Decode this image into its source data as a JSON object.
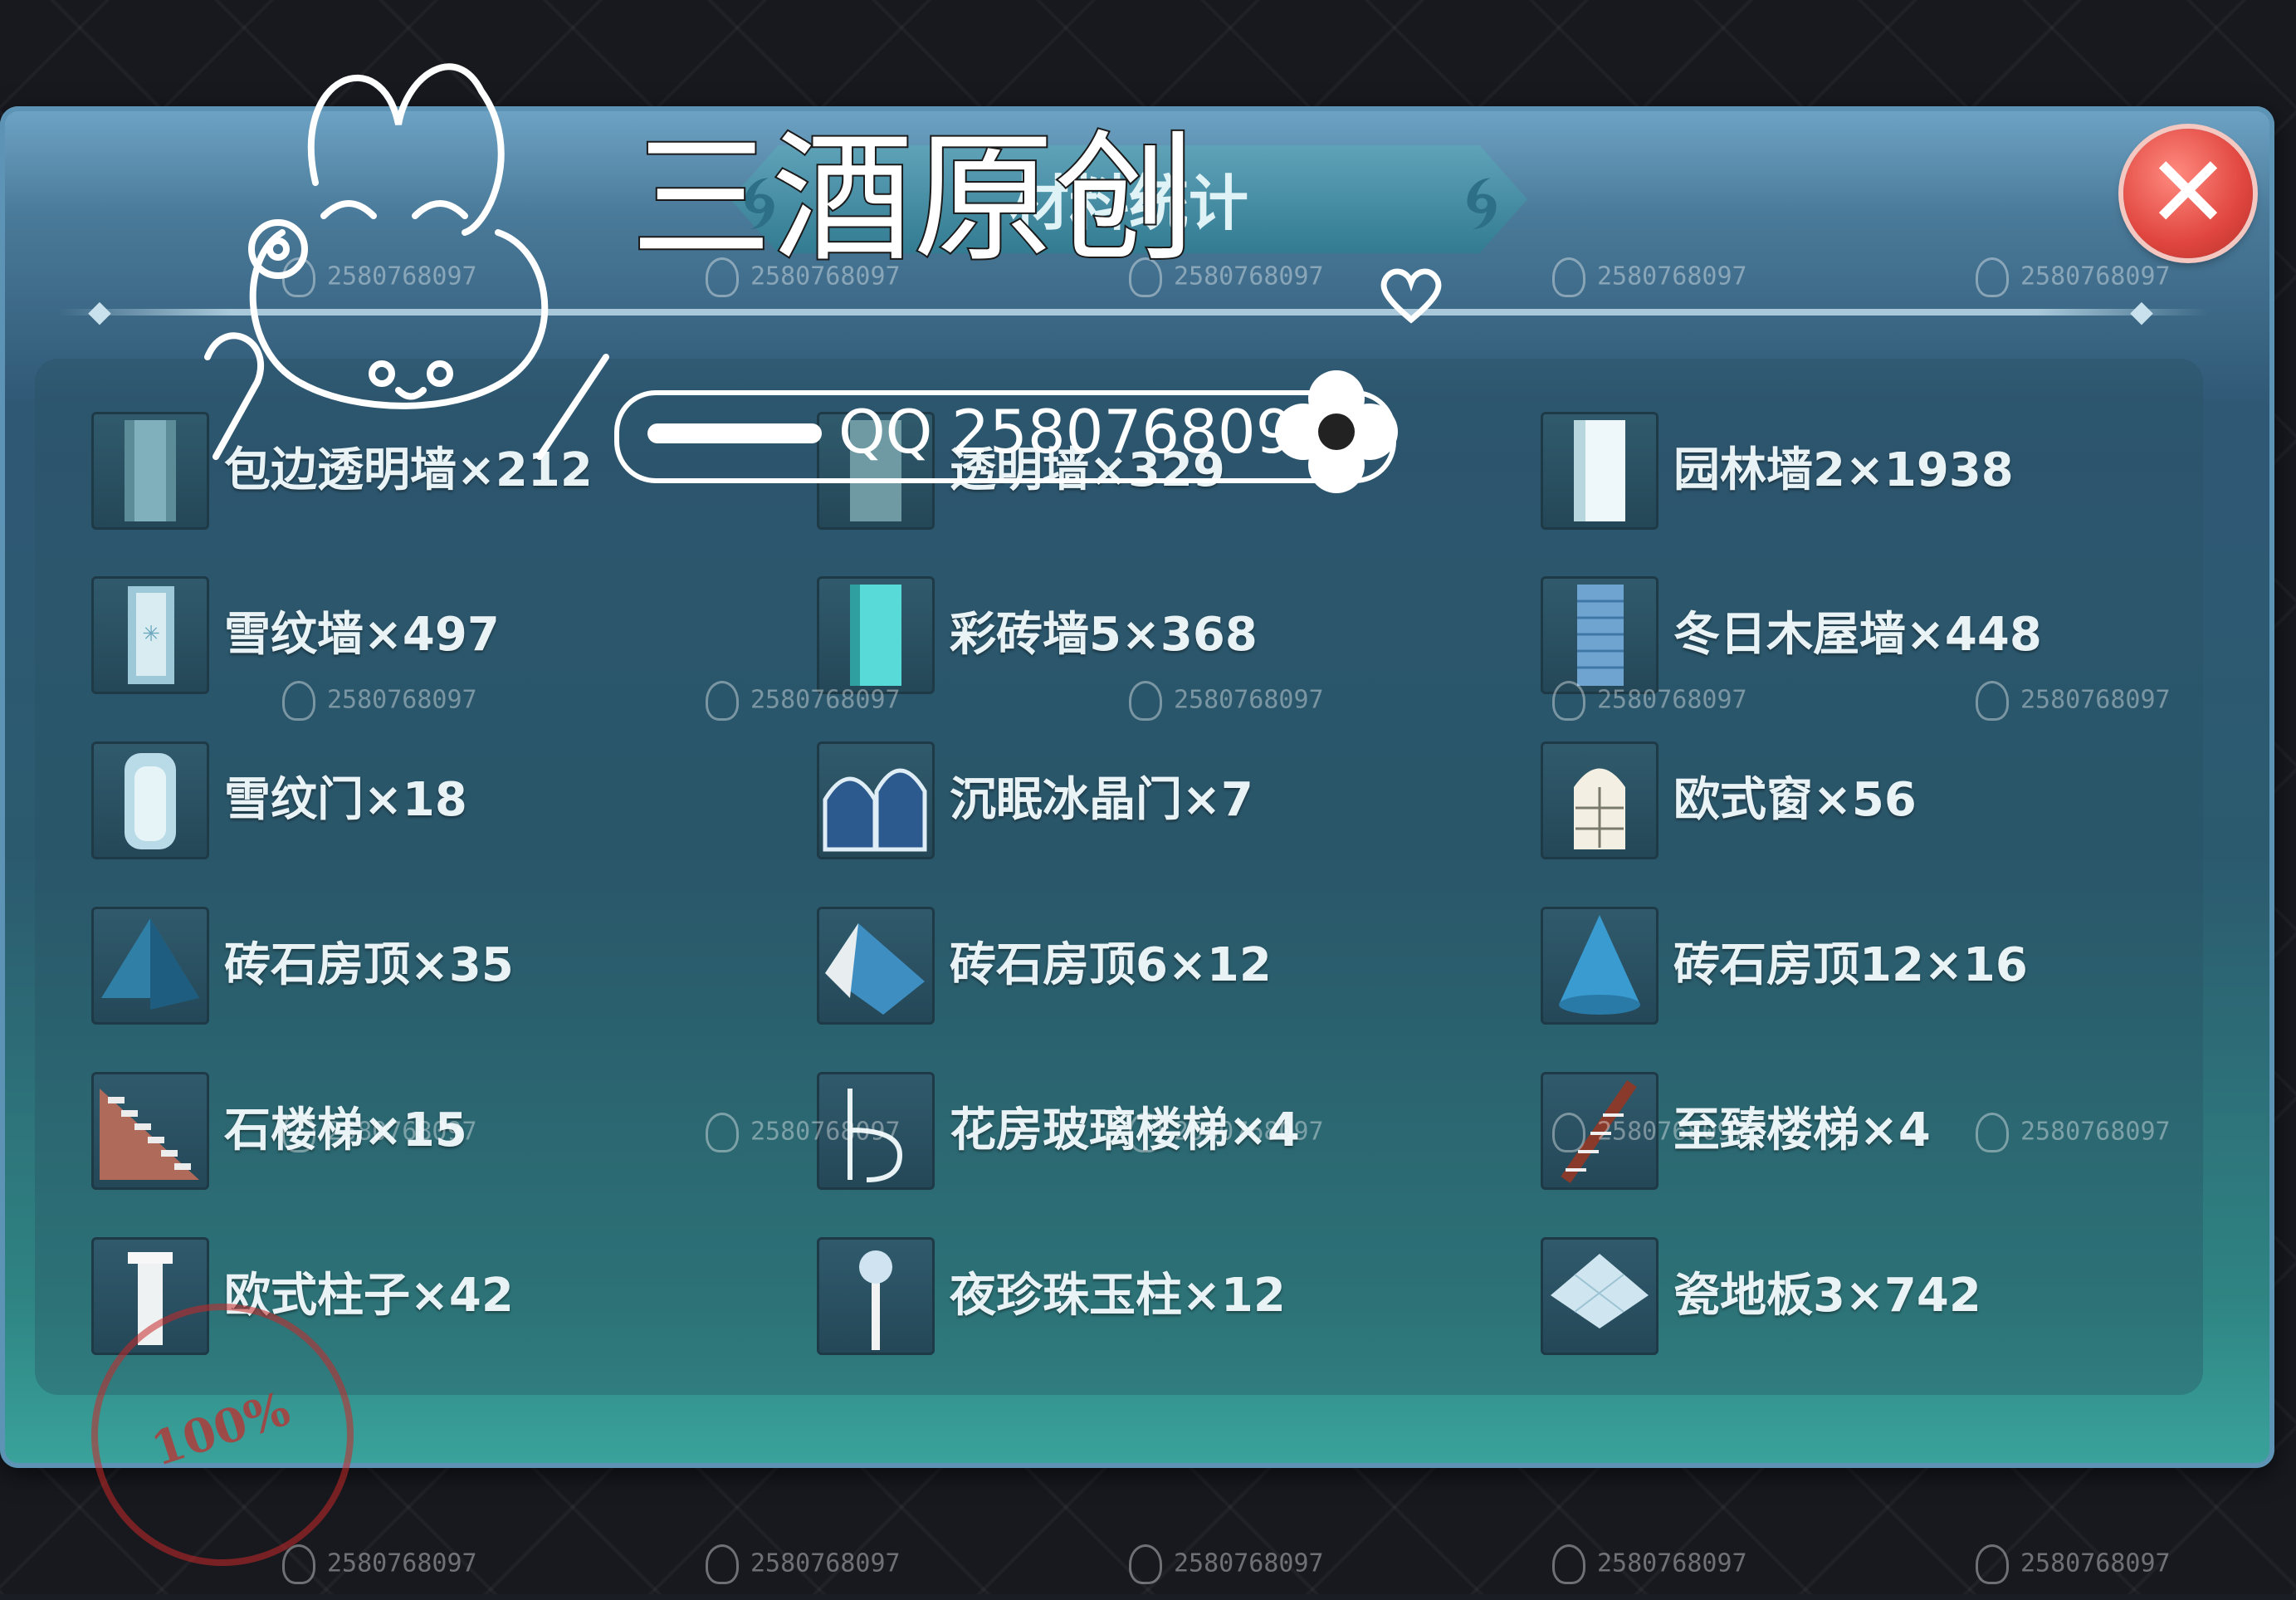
{
  "title": "材料统计",
  "overlay": {
    "brand": "三酒原创",
    "qq": "QQ 2580768097",
    "stamp": "100%"
  },
  "watermark_text": "2580768097",
  "close_icon": "close-icon",
  "items": [
    {
      "label": "包边透明墙×212",
      "icon": "glass-wall-icon"
    },
    {
      "label": "透明墙×329",
      "icon": "transparent-wall-icon"
    },
    {
      "label": "园林墙2×1938",
      "icon": "garden-wall-icon"
    },
    {
      "label": "雪纹墙×497",
      "icon": "snow-wall-icon"
    },
    {
      "label": "彩砖墙5×368",
      "icon": "color-brick-wall-icon"
    },
    {
      "label": "冬日木屋墙×448",
      "icon": "winter-cabin-wall-icon"
    },
    {
      "label": "雪纹门×18",
      "icon": "snow-door-icon"
    },
    {
      "label": "沉眠冰晶门×7",
      "icon": "ice-crystal-door-icon"
    },
    {
      "label": "欧式窗×56",
      "icon": "european-window-icon"
    },
    {
      "label": "砖石房顶×35",
      "icon": "pyramid-roof-icon"
    },
    {
      "label": "砖石房顶6×12",
      "icon": "gable-roof-icon"
    },
    {
      "label": "砖石房顶12×16",
      "icon": "cone-roof-icon"
    },
    {
      "label": "石楼梯×15",
      "icon": "stone-stairs-icon"
    },
    {
      "label": "花房玻璃楼梯×4",
      "icon": "spiral-stairs-icon"
    },
    {
      "label": "至臻楼梯×4",
      "icon": "premium-stairs-icon"
    },
    {
      "label": "欧式柱子×42",
      "icon": "european-pillar-icon"
    },
    {
      "label": "夜珍珠玉柱×12",
      "icon": "pearl-pillar-icon"
    },
    {
      "label": "瓷地板3×742",
      "icon": "porcelain-floor-icon"
    }
  ]
}
